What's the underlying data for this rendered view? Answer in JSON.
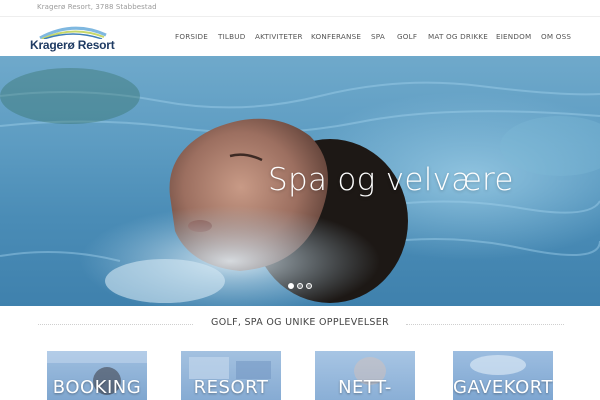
{
  "topbar": {
    "address": "Kragerø Resort, 3788 Stabbestad"
  },
  "header": {
    "logo_text": "Kragerø Resort",
    "nav": [
      "FORSIDE",
      "TILBUD",
      "AKTIVITETER",
      "KONFERANSE",
      "SPA",
      "GOLF",
      "MAT OG DRIKKE",
      "EIENDOM",
      "OM OSS"
    ]
  },
  "hero": {
    "caption": "Spa og velvære",
    "slides_total": 3,
    "active_slide": 1
  },
  "section": {
    "title": "GOLF, SPA OG UNIKE OPPLEVELSER"
  },
  "tiles": [
    "BOOKING",
    "RESORT",
    "NETT-",
    "GAVEKORT"
  ],
  "colors": {
    "logo_blue": "#1f3b63",
    "water_blue": "#5d9cc2",
    "tile_overlay": "#7fa9d3"
  }
}
